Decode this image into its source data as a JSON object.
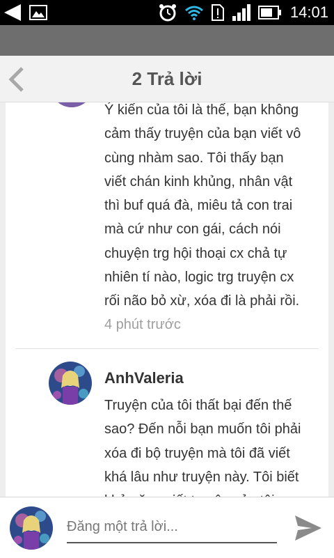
{
  "status_bar": {
    "time": "14:01",
    "icons": [
      "back-arrow-icon",
      "image-icon",
      "alarm-clock-icon",
      "wifi-icon",
      "sim-alert-icon",
      "signal-icon",
      "battery-icon"
    ]
  },
  "header": {
    "title": "2 Trả lời",
    "back_icon": "chevron-left-icon"
  },
  "comments": [
    {
      "lines": [
        "Ý kiến của tôi là thế, bạn không",
        "cảm thấy truyện của bạn viết vô",
        "cùng nhàm sao. Tôi thấy bạn",
        "viết chán kinh khủng, nhân vật",
        "thì buf quá đà, miêu tả con trai",
        "mà cứ như con gái, cách nói",
        "chuyện trg hội thoại cx chả tự",
        "nhiên tí nào, logic trg truyện cx",
        "rối não bỏ xừ, xóa đi là phải rồi."
      ],
      "time": "4 phút trước"
    },
    {
      "author": "AnhValeria",
      "lines": [
        "Truyện của tôi thất bại đến thế",
        "sao? Đến nỗi bạn muốn tôi phải",
        "xóa đi bộ truyện mà tôi đã viết",
        "khá lâu như truyện này. Tôi biết",
        "khả năng viết truyện của tôi"
      ]
    }
  ],
  "reply": {
    "placeholder": "Đăng một trả lời...",
    "send_icon": "send-icon"
  },
  "colors": {
    "status_bar": "#000000",
    "app_bar": "#6e6e6e",
    "header_bg": "#f2f2f2",
    "content_bg": "#ffffff",
    "timestamp": "#9e9e9e"
  }
}
